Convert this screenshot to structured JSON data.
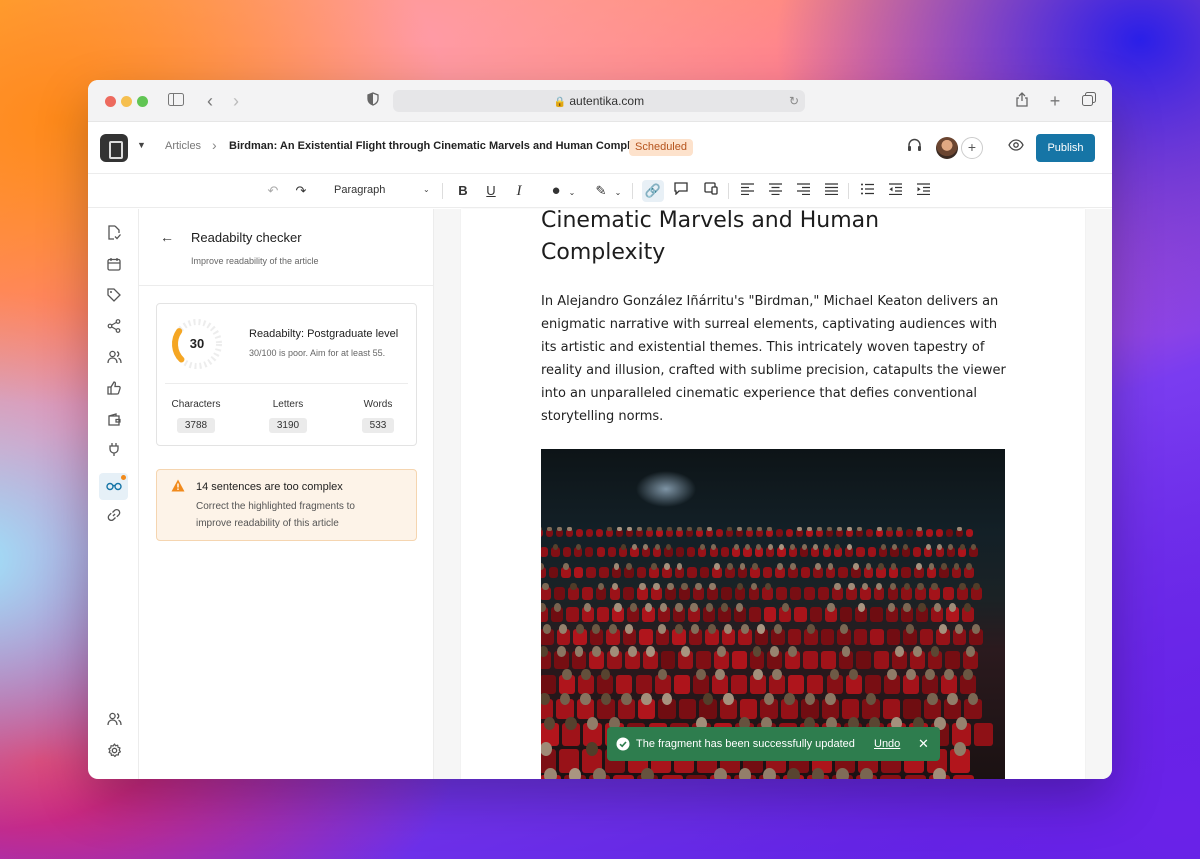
{
  "browser": {
    "url": "autentika.com"
  },
  "header": {
    "breadcrumb_root": "Articles",
    "breadcrumb_title": "Birdman: An Existential Flight through Cinematic Marvels and Human Complexity",
    "status_badge": "Scheduled",
    "publish_label": "Publish"
  },
  "toolbar": {
    "block_style": "Paragraph"
  },
  "panel": {
    "title": "Readabilty checker",
    "subtitle": "Improve readability of the article",
    "score": "30",
    "score_fraction": 0.3,
    "level": "Readabilty: Postgraduate level",
    "hint": "30/100 is poor. Aim for at least 55.",
    "stats": [
      {
        "label": "Characters",
        "value": "3788"
      },
      {
        "label": "Letters",
        "value": "3190"
      },
      {
        "label": "Words",
        "value": "533"
      }
    ],
    "warning_title": "14 sentences are too complex",
    "warning_body_1": "Correct the highlighted fragments to",
    "warning_body_2": "improve readability of this article"
  },
  "document": {
    "heading_line1": "Cinematic Marvels and Human",
    "heading_line2": "Complexity",
    "paragraph": "In Alejandro González Iñárritu's \"Birdman,\" Michael Keaton delivers an enigmatic narrative with surreal elements, captivating audiences with its artistic and existential themes. This intricately woven tapestry of reality and illusion, crafted with sublime precision, catapults the viewer into an unparalleled cinematic experience that defies conventional storytelling norms."
  },
  "toast": {
    "message": "The fragment has been successfully updated",
    "undo_label": "Undo"
  },
  "colors": {
    "accent": "#1675a6",
    "warning": "#f18a1c",
    "success": "#2e7d4e",
    "gauge_fill": "#f5a623"
  }
}
